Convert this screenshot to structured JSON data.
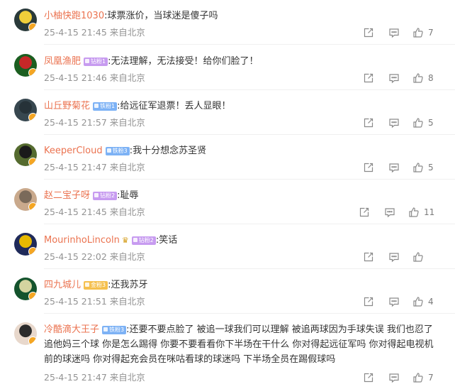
{
  "comments": [
    {
      "user": "小柚快跑1030",
      "badge": "",
      "badge_style": "",
      "crown": false,
      "text": ":球票涨价，当球迷是傻子吗",
      "time": "25-4-15 21:45",
      "location": "来自北京",
      "likes": "7",
      "avatar_colors": [
        "#2a3a3a",
        "#f0cf3a"
      ]
    },
    {
      "user": "凤凰渔肥",
      "badge": "钻粉1",
      "badge_style": "purple",
      "crown": false,
      "text": ":无法理解，无法接受！给你们脸了！",
      "time": "25-4-15 21:46",
      "location": "来自北京",
      "likes": "8",
      "avatar_colors": [
        "#1b5e20",
        "#c62828"
      ]
    },
    {
      "user": "山丘野菊花",
      "badge": "铁粉1",
      "badge_style": "blue",
      "crown": false,
      "text": ":给远征军退票！丢人显眼！",
      "time": "25-4-15 21:57",
      "location": "来自北京",
      "likes": "5",
      "avatar_colors": [
        "#37474f",
        "#263238"
      ]
    },
    {
      "user": "KeeperCloud",
      "badge": "铁粉3",
      "badge_style": "blue",
      "crown": false,
      "text": ":我十分想念苏圣贤",
      "time": "25-4-15 21:47",
      "location": "来自北京",
      "likes": "5",
      "avatar_colors": [
        "#556b2f",
        "#1a1a1a"
      ]
    },
    {
      "user": "赵二宝子呀",
      "badge": "钻粉2",
      "badge_style": "purple",
      "crown": false,
      "text": ":耻辱",
      "time": "25-4-15 21:45",
      "location": "来自北京",
      "likes": "11",
      "avatar_colors": [
        "#c9a98c",
        "#7a6a5a"
      ]
    },
    {
      "user": "MourinhoLincoln",
      "badge": "钻粉2",
      "badge_style": "purple",
      "crown": true,
      "text": ":笑话",
      "time": "25-4-15 22:02",
      "location": "来自北京",
      "likes": "",
      "avatar_colors": [
        "#1f2a5a",
        "#e6b800"
      ]
    },
    {
      "user": "四九城儿",
      "badge": "金粉3",
      "badge_style": "gold",
      "crown": false,
      "text": ":还我苏牙",
      "time": "25-4-15 21:51",
      "location": "来自北京",
      "likes": "4",
      "avatar_colors": [
        "#14532d",
        "#d4d4a0"
      ]
    },
    {
      "user": "冷酷滴大王子",
      "badge": "铁粉3",
      "badge_style": "blue",
      "crown": false,
      "text": ":还要不要点脸了 被追一球我们可以理解 被追两球因为手球失误 我们也忍了 追他妈三个球 你是怎么踢得 你要不要看看你下半场在干什么 你对得起远征军吗 你对得起电视机前的球迷吗 你对得起充会员在咪咕看球的球迷吗 下半场全员在踢假球吗",
      "time": "25-4-15 21:47",
      "location": "来自北京",
      "likes": "7",
      "avatar_colors": [
        "#e8d8cc",
        "#2b2b2b"
      ]
    }
  ]
}
